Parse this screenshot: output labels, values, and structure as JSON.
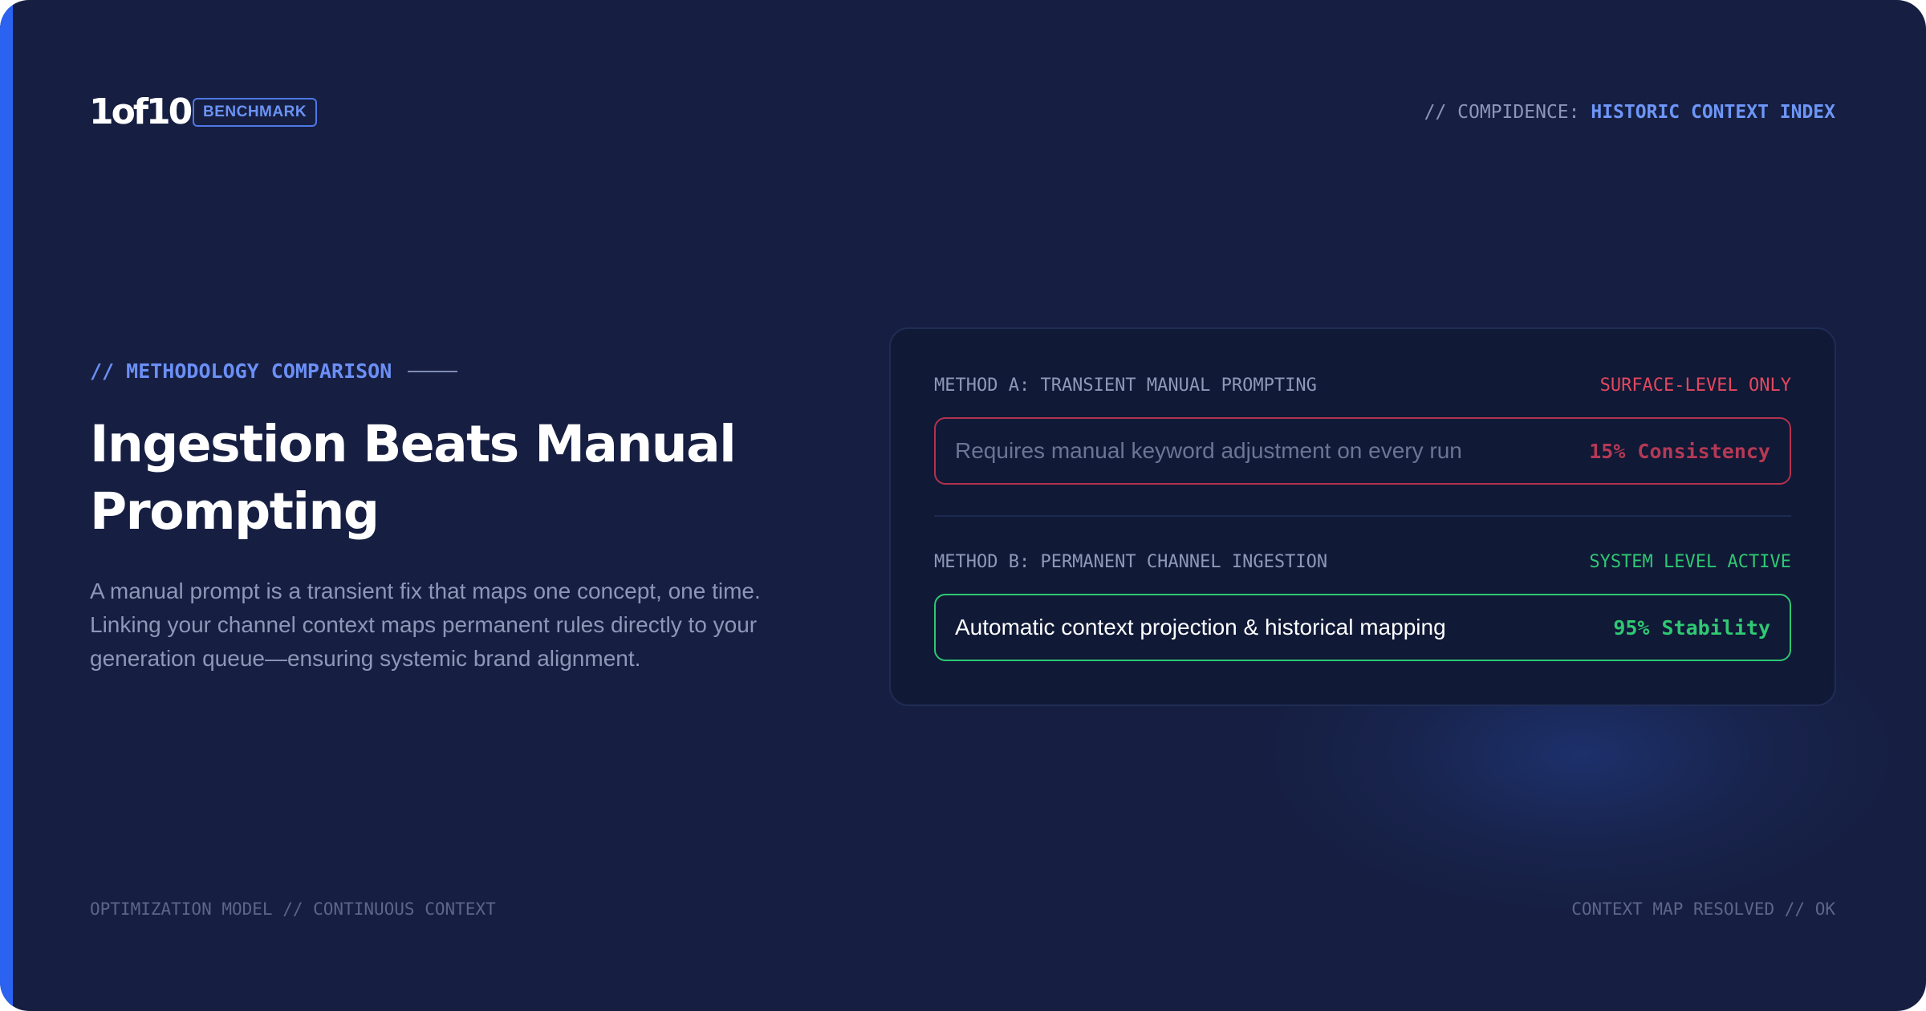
{
  "brand": {
    "logo": "1of10",
    "badge": "BENCHMARK"
  },
  "header": {
    "prefix": "// COMPIDENCE:",
    "highlight": "HISTORIC CONTEXT INDEX"
  },
  "intro": {
    "eyebrow": "// METHODOLOGY COMPARISON",
    "title": "Ingestion Beats Manual Prompting",
    "description": "A manual prompt is a transient fix that maps one concept, one time. Linking your channel context maps permanent rules directly to your generation queue—ensuring systemic brand alignment."
  },
  "comparison": {
    "method_a": {
      "label": "METHOD A: TRANSIENT MANUAL PROMPTING",
      "status": "SURFACE-LEVEL ONLY",
      "description": "Requires manual keyword adjustment on every run",
      "metric": "15% Consistency"
    },
    "method_b": {
      "label": "METHOD B: PERMANENT CHANNEL INGESTION",
      "status": "SYSTEM LEVEL ACTIVE",
      "description": "Automatic context projection & historical mapping",
      "metric": "95% Stability"
    }
  },
  "footer": {
    "left": "OPTIMIZATION MODEL // CONTINUOUS CONTEXT",
    "right": "CONTEXT MAP RESOLVED // OK"
  },
  "colors": {
    "background": "#161f42",
    "accent": "#2b63f0",
    "highlight": "#6d96f7",
    "negative": "#e3485f",
    "positive": "#2fc873"
  }
}
